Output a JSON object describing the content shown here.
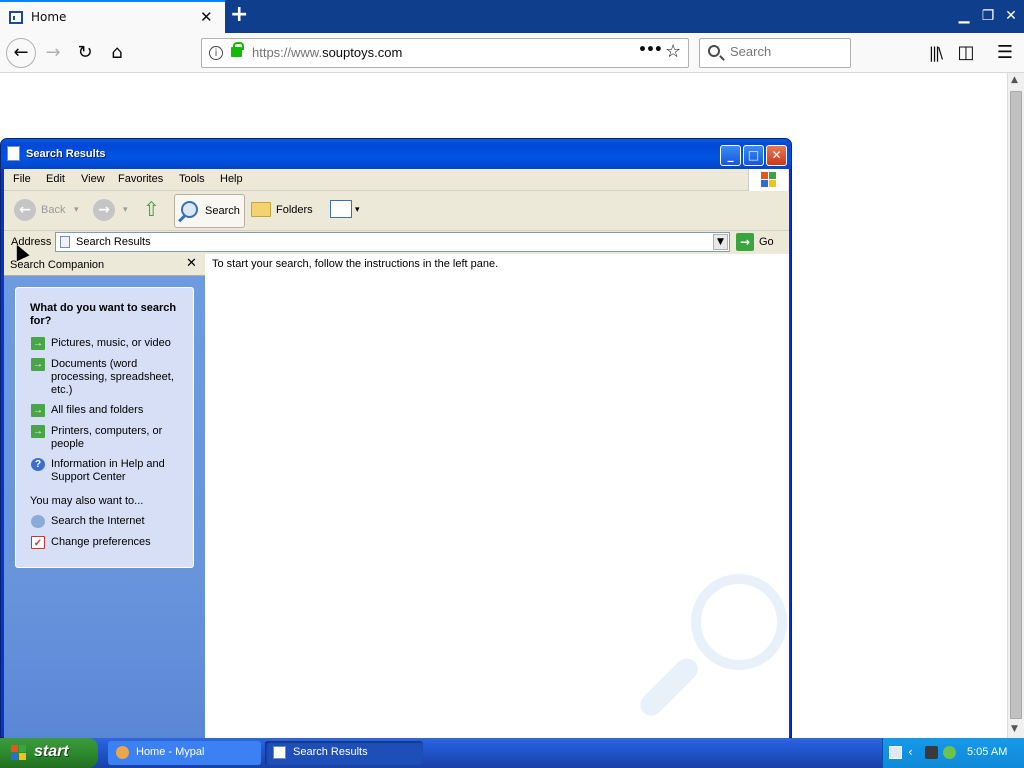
{
  "browser": {
    "tab_label": "Home",
    "url_prefix": "https://www.",
    "url_domain": "souptoys.com",
    "search_placeholder": "Search"
  },
  "window": {
    "title": "Search Results",
    "menu": [
      "File",
      "Edit",
      "View",
      "Favorites",
      "Tools",
      "Help"
    ],
    "toolbar": {
      "back_label": "Back",
      "search_label": "Search",
      "folders_label": "Folders"
    },
    "address": {
      "label": "Address",
      "value": "Search Results",
      "go_label": "Go"
    },
    "pane": {
      "title": "Search Companion",
      "question": "What do you want to search for?",
      "options": [
        "Pictures, music, or video",
        "Documents (word processing, spreadsheet, etc.)",
        "All files and folders",
        "Printers, computers, or people",
        "Information in Help and Support Center"
      ],
      "also_label": "You may also want to...",
      "also_options": [
        "Search the Internet",
        "Change preferences"
      ]
    },
    "content_message": "To start your search, follow the instructions in the left pane."
  },
  "taskbar": {
    "start_label": "start",
    "tasks": [
      "Home - Mypal",
      "Search Results"
    ],
    "clock": "5:05 AM"
  },
  "colors": {
    "xp_title_blue": "#0054e3",
    "start_green": "#2e8a2e",
    "pane_blue": "#6e9ae0",
    "firefox_tabbar": "#0f3f8c"
  }
}
